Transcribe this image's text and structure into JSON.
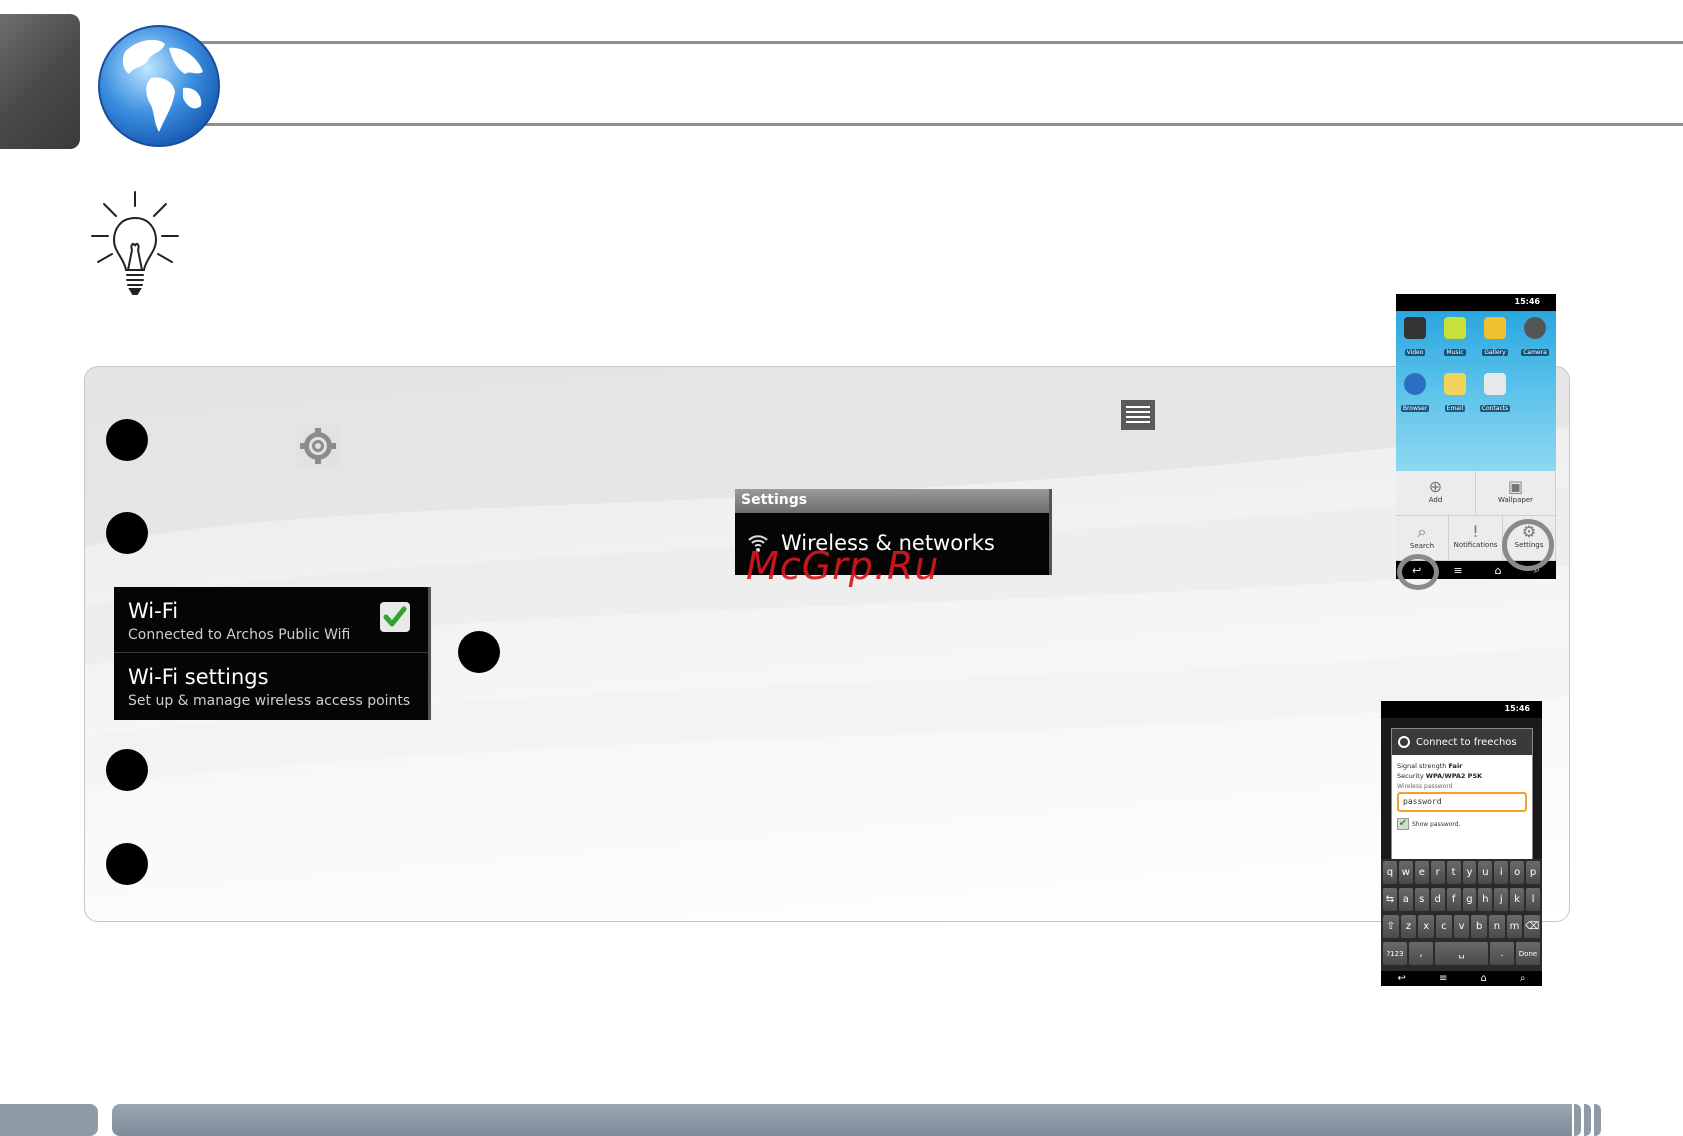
{
  "header": {
    "globe_icon": "globe-icon"
  },
  "tip": {
    "icon": "lightbulb-icon"
  },
  "steps": {
    "gear_icon": "settings-gear-icon",
    "menu_icon": "menu-icon"
  },
  "settings_screen": {
    "header": "Settings",
    "item": "Wireless & networks",
    "item_icon": "wifi-icon"
  },
  "watermark": "McGrp.Ru",
  "wifi_screen": {
    "items": [
      {
        "title": "Wi-Fi",
        "subtitle": "Connected to Archos Public Wifi",
        "checked": true
      },
      {
        "title": "Wi-Fi settings",
        "subtitle": "Set up & manage wireless access points"
      }
    ]
  },
  "phone_home": {
    "time": "15:46",
    "apps_row1": [
      "Video",
      "Music",
      "Gallery",
      "Camera"
    ],
    "apps_row2": [
      "Browser",
      "Email",
      "Contacts"
    ],
    "menu": [
      "Add",
      "Wallpaper",
      "Search",
      "Notifications",
      "Settings"
    ]
  },
  "phone_connect": {
    "time": "15:46",
    "dialog_title": "Connect to freechos",
    "signal_label": "Signal strength",
    "signal_value": "Fair",
    "security_label": "Security",
    "security_value": "WPA/WPA2 PSK",
    "password_label": "Wireless password",
    "password_value": "password",
    "show_password": "Show password.",
    "keyboard": {
      "row1": [
        "q",
        "w",
        "e",
        "r",
        "t",
        "y",
        "u",
        "i",
        "o",
        "p"
      ],
      "row2": [
        "a",
        "s",
        "d",
        "f",
        "g",
        "h",
        "j",
        "k",
        "l"
      ],
      "row3": [
        "z",
        "x",
        "c",
        "v",
        "b",
        "n",
        "m"
      ],
      "sym": "?123",
      "done": "Done"
    }
  }
}
